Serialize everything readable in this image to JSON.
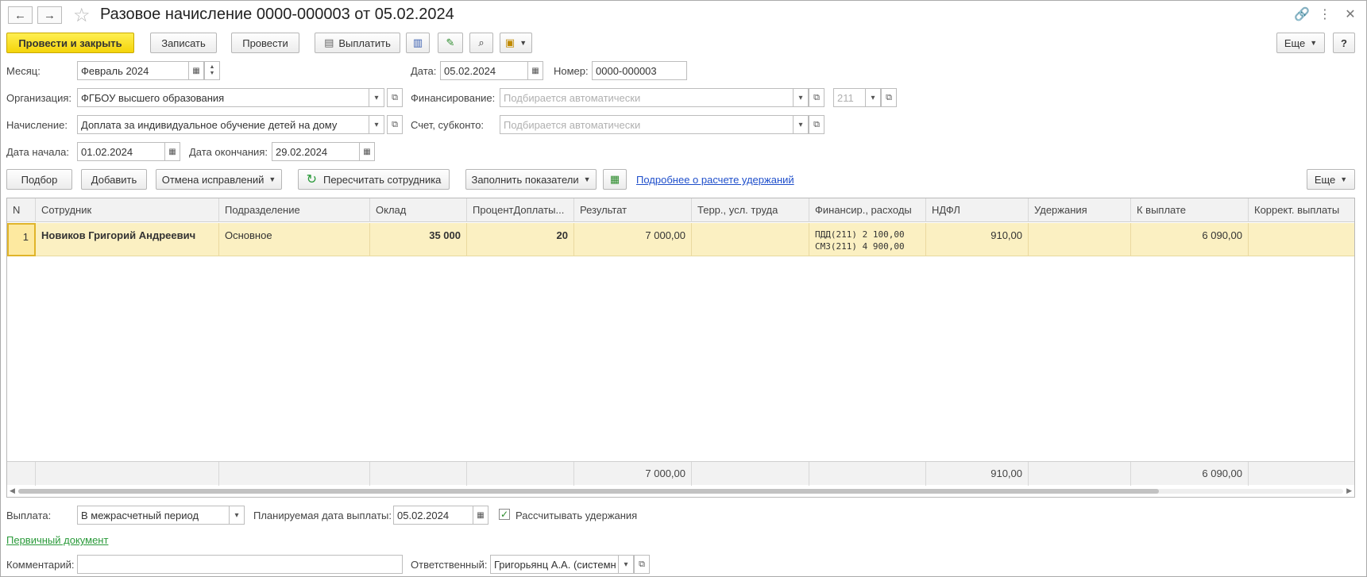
{
  "window": {
    "title": "Разовое начисление 0000-000003 от 05.02.2024"
  },
  "icons": {
    "back": "←",
    "forward": "→",
    "star": "☆",
    "link": "🔗",
    "more_vert": "⋮",
    "close": "✕",
    "calendar": "▦",
    "dropdown": "▾",
    "open": "⧉",
    "refresh": "↻",
    "check": "✓"
  },
  "toolbar": {
    "post_close": "Провести и закрыть",
    "save": "Записать",
    "post": "Провести",
    "pay": "Выплатить",
    "more": "Еще",
    "help": "?"
  },
  "form": {
    "month_label": "Месяц:",
    "month_value": "Февраль 2024",
    "date_label": "Дата:",
    "date_value": "05.02.2024",
    "number_label": "Номер:",
    "number_value": "0000-000003",
    "org_label": "Организация:",
    "org_value": "ФГБОУ высшего образования",
    "financing_label": "Финансирование:",
    "financing_placeholder": "Подбирается автоматически",
    "financing_code": "211",
    "accrual_label": "Начисление:",
    "accrual_value": "Доплата за индивидуальное обучение детей на дому",
    "account_label": "Счет, субконто:",
    "account_placeholder": "Подбирается автоматически",
    "start_label": "Дата начала:",
    "start_value": "01.02.2024",
    "end_label": "Дата окончания:",
    "end_value": "29.02.2024"
  },
  "table_toolbar": {
    "select": "Подбор",
    "add": "Добавить",
    "cancel_fix": "Отмена исправлений",
    "recalc": "Пересчитать сотрудника",
    "fill": "Заполнить показатели",
    "details_link": "Подробнее о расчете удержаний",
    "more": "Еще"
  },
  "table": {
    "columns": [
      "N",
      "Сотрудник",
      "Подразделение",
      "Оклад",
      "ПроцентДоплаты...",
      "Результат",
      "Терр., усл. труда",
      "Финансир., расходы",
      "НДФЛ",
      "Удержания",
      "К выплате",
      "Коррект. выплаты"
    ],
    "rows": [
      {
        "n": "1",
        "employee": "Новиков Григорий Андреевич",
        "division": "Основное",
        "salary": "35 000",
        "percent": "20",
        "result": "7 000,00",
        "terr": "",
        "fin_line1": "ПДД(211) 2 100,00",
        "fin_line2": "СМЗ(211) 4 900,00",
        "ndfl": "910,00",
        "deductions": "",
        "to_pay": "6 090,00",
        "correction": ""
      }
    ],
    "totals": {
      "result": "7 000,00",
      "ndfl": "910,00",
      "to_pay": "6 090,00"
    }
  },
  "footer": {
    "payment_label": "Выплата:",
    "payment_value": "В межрасчетный период",
    "planned_label": "Планируемая дата выплаты:",
    "planned_value": "05.02.2024",
    "calc_deductions": "Рассчитывать удержания",
    "calc_deductions_checked": true,
    "primary_doc": "Первичный документ",
    "comment_label": "Комментарий:",
    "comment_value": "",
    "responsible_label": "Ответственный:",
    "responsible_value": "Григорьянц А.А. (системн"
  },
  "colors": {
    "primary_button": "#f4d40a",
    "row_highlight": "#fbf0c2",
    "link": "#1f4fcb",
    "link_green": "#2a9a3a"
  }
}
